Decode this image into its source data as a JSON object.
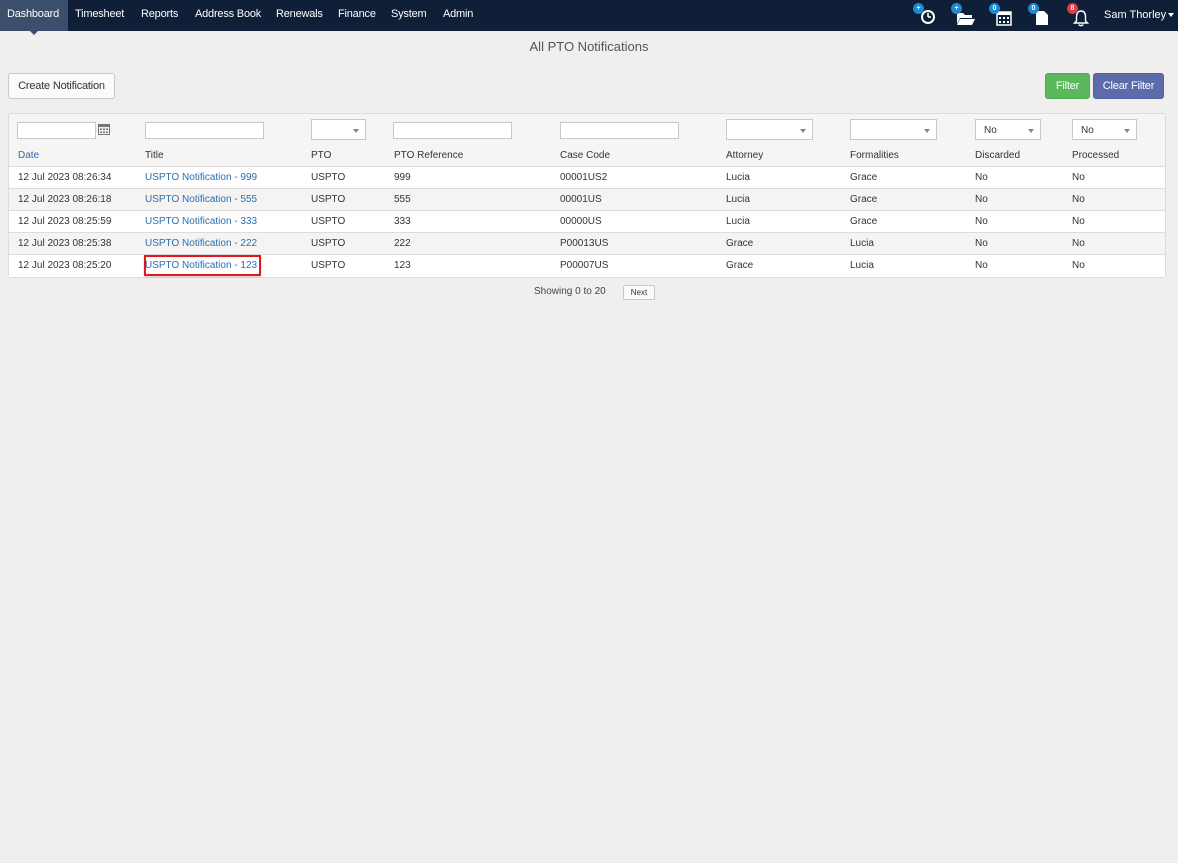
{
  "nav": {
    "items": [
      "Dashboard",
      "Timesheet",
      "Reports",
      "Address Book",
      "Renewals",
      "Finance",
      "System",
      "Admin"
    ],
    "active": "Dashboard",
    "icons": [
      {
        "name": "timer-icon",
        "badge": "+"
      },
      {
        "name": "folder-open-icon",
        "badge": "+"
      },
      {
        "name": "calendar-icon",
        "badge": "0"
      },
      {
        "name": "document-icon",
        "badge": "0"
      },
      {
        "name": "bell-icon",
        "badge": "8"
      }
    ],
    "user": "Sam Thorley"
  },
  "page": {
    "title": "All PTO Notifications",
    "create_button": "Create Notification",
    "filter_button": "Filter",
    "clear_filter_button": "Clear Filter"
  },
  "filters": {
    "discarded": "No",
    "processed": "No"
  },
  "table": {
    "columns": [
      "Date",
      "Title",
      "PTO",
      "PTO Reference",
      "Case Code",
      "Attorney",
      "Formalities",
      "Discarded",
      "Processed"
    ],
    "rows": [
      [
        "12 Jul 2023 08:26:34",
        "USPTO Notification - 999",
        "USPTO",
        "999",
        "00001US2",
        "Lucia",
        "Grace",
        "No",
        "No"
      ],
      [
        "12 Jul 2023 08:26:18",
        "USPTO Notification - 555",
        "USPTO",
        "555",
        "00001US",
        "Lucia",
        "Grace",
        "No",
        "No"
      ],
      [
        "12 Jul 2023 08:25:59",
        "USPTO Notification - 333",
        "USPTO",
        "333",
        "00000US",
        "Lucia",
        "Grace",
        "No",
        "No"
      ],
      [
        "12 Jul 2023 08:25:38",
        "USPTO Notification - 222",
        "USPTO",
        "222",
        "P00013US",
        "Grace",
        "Lucia",
        "No",
        "No"
      ],
      [
        "12 Jul 2023 08:25:20",
        "USPTO Notification - 123",
        "USPTO",
        "123",
        "P00007US",
        "Grace",
        "Lucia",
        "No",
        "No"
      ]
    ]
  },
  "pager": {
    "text": "Showing 0 to 20",
    "next": "Next"
  },
  "colors": {
    "nav_bg": "#0f1f38",
    "link": "#2a6fb0",
    "filter_green": "#5cb85c",
    "clear_filter_indigo": "#5e6bab",
    "highlight_red": "#e0181b"
  }
}
